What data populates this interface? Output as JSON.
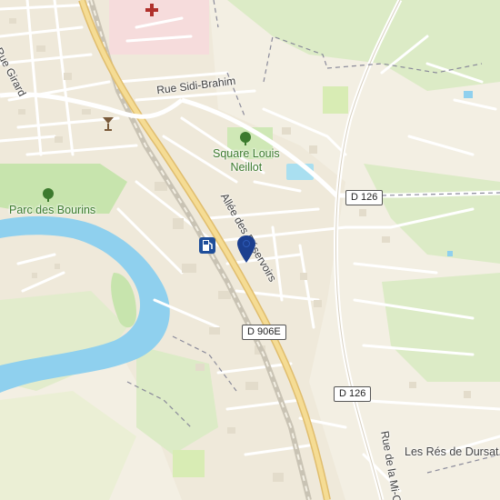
{
  "map": {
    "streets": {
      "rue_girard": "Rue Girard",
      "rue_sidi_brahim": "Rue Sidi-Brahim",
      "allee_reservoirs": "Allée des Réservoirs",
      "rue_mi_cote": "Rue de la Mi-Côte"
    },
    "places": {
      "square_louis_neillot_line1": "Square Louis",
      "square_louis_neillot_line2": "Neillot",
      "parc_des_bourins": "Parc des Bourins",
      "res_de_dursat": "Les Rés de Dursat"
    },
    "road_shields": {
      "d126_top": "D 126",
      "d906e": "D 906E",
      "d126_bottom": "D 126"
    },
    "icons": {
      "hospital": "hospital-cross-icon",
      "bar": "cocktail-bar-icon",
      "fuel": "fuel-station-icon",
      "marker": "location-marker-icon",
      "park": "tree-icon"
    },
    "colors": {
      "background": "#f3efe3",
      "water": "#8fd0ee",
      "park": "#cfe8b6",
      "main_road": "#f1d58c",
      "marker": "#1c3f8f"
    }
  }
}
